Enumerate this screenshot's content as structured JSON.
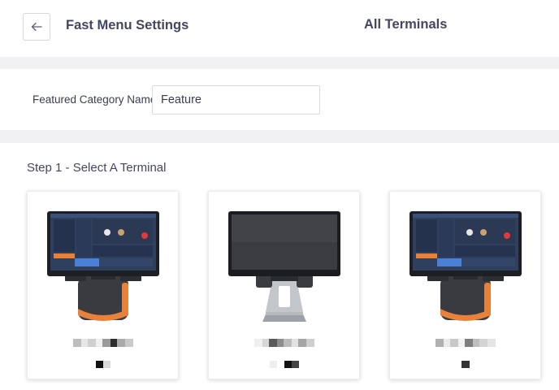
{
  "header": {
    "title": "Fast Menu Settings",
    "terminals_title": "All Terminals"
  },
  "category": {
    "label": "Featured Category Name:",
    "value": "Feature"
  },
  "terminals": {
    "step_title": "Step 1 - Select A Terminal",
    "cards": [
      {
        "device": "pos-terminal-dual-screen-image"
      },
      {
        "device": "pos-terminal-stand-image"
      },
      {
        "device": "pos-terminal-dual-screen-image"
      }
    ]
  },
  "colors": {
    "accent_orange": "#e8823a",
    "text": "#3a3c52",
    "device_dark": "#2a2b30"
  }
}
